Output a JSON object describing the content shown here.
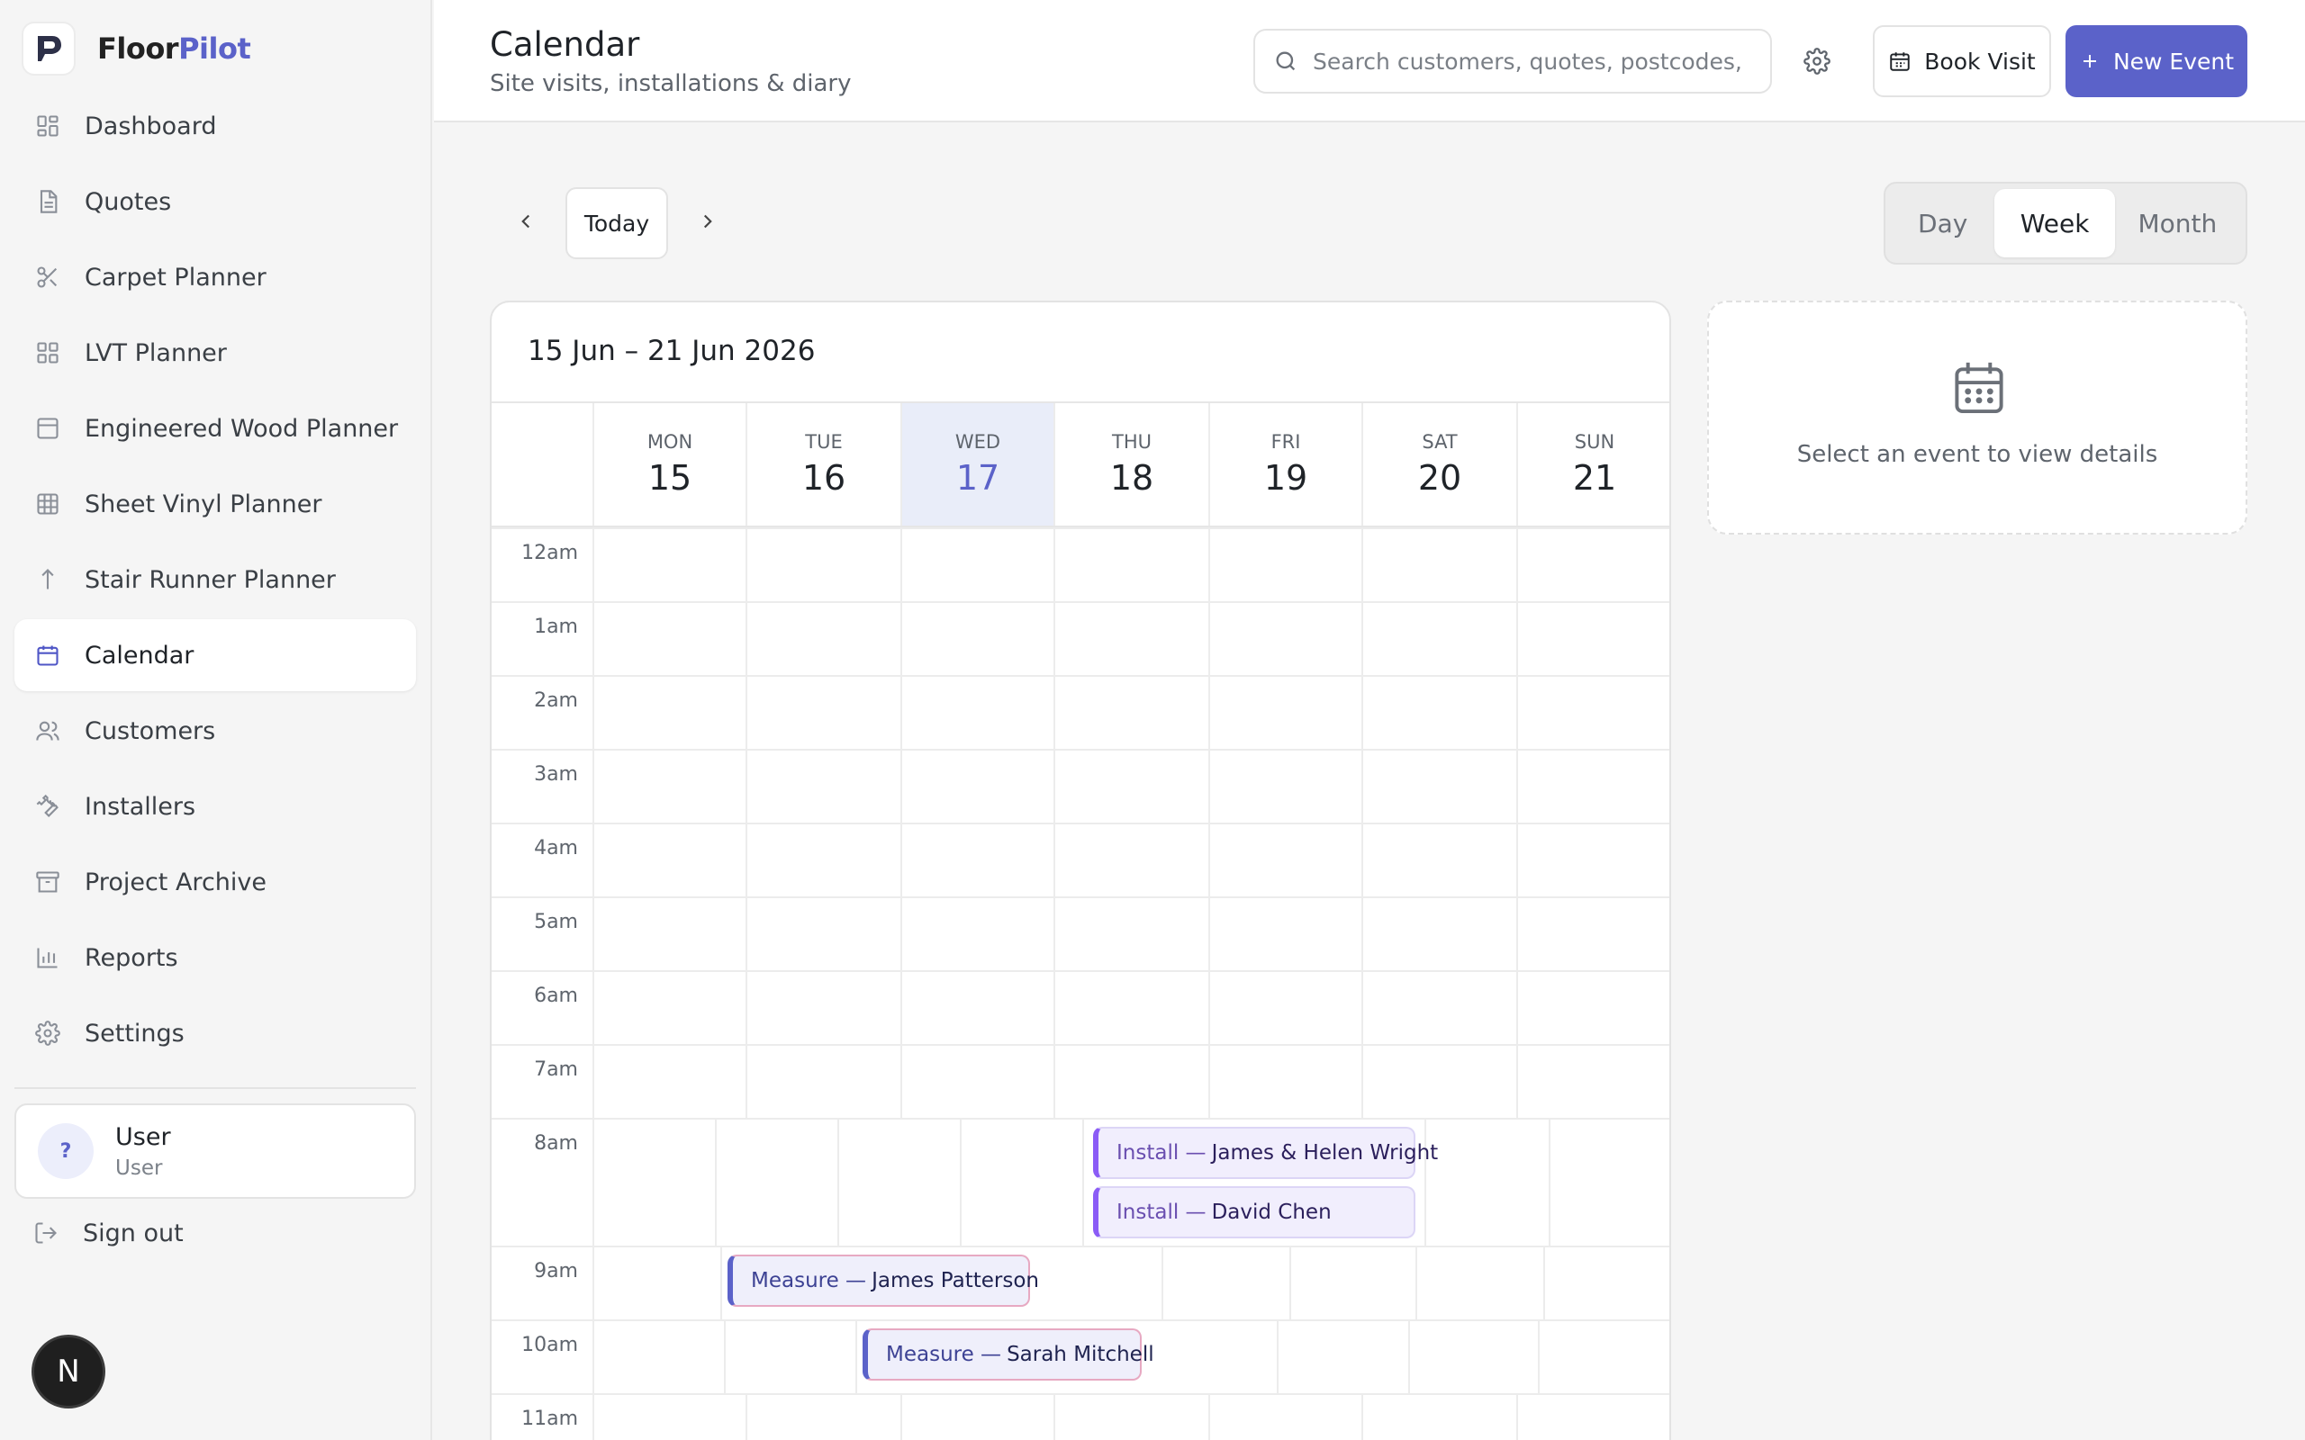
{
  "brand": {
    "name_part1": "Floor",
    "name_part2": "Pilot"
  },
  "sidebar": {
    "items": [
      {
        "label": "Dashboard",
        "icon": "dashboard-icon"
      },
      {
        "label": "Quotes",
        "icon": "document-icon"
      },
      {
        "label": "Carpet Planner",
        "icon": "scissors-icon"
      },
      {
        "label": "LVT Planner",
        "icon": "grid-icon"
      },
      {
        "label": "Engineered Wood Planner",
        "icon": "panel-icon"
      },
      {
        "label": "Sheet Vinyl Planner",
        "icon": "table-icon"
      },
      {
        "label": "Stair Runner Planner",
        "icon": "arrow-up-icon"
      },
      {
        "label": "Calendar",
        "icon": "calendar-icon",
        "active": true
      },
      {
        "label": "Customers",
        "icon": "users-icon"
      },
      {
        "label": "Installers",
        "icon": "wrench-icon"
      },
      {
        "label": "Project Archive",
        "icon": "archive-icon"
      },
      {
        "label": "Reports",
        "icon": "bar-chart-icon"
      },
      {
        "label": "Settings",
        "icon": "gear-icon"
      }
    ],
    "user": {
      "avatar": "?",
      "name": "User",
      "role": "User"
    },
    "signout_label": "Sign out",
    "badge": "N"
  },
  "header": {
    "title": "Calendar",
    "subtitle": "Site visits, installations & diary",
    "search_placeholder": "Search customers, quotes, postcodes, projects...",
    "book_visit_label": "Book Visit",
    "new_event_label": "New Event",
    "accent_color": "#5b62c9"
  },
  "toolbar": {
    "today_label": "Today",
    "views": [
      "Day",
      "Week",
      "Month"
    ],
    "active_view": "Week"
  },
  "calendar": {
    "range": "15 Jun – 21 Jun 2026",
    "days": [
      {
        "name": "MON",
        "num": "15"
      },
      {
        "name": "TUE",
        "num": "16"
      },
      {
        "name": "WED",
        "num": "17",
        "today": true
      },
      {
        "name": "THU",
        "num": "18"
      },
      {
        "name": "FRI",
        "num": "19"
      },
      {
        "name": "SAT",
        "num": "20"
      },
      {
        "name": "SUN",
        "num": "21"
      }
    ],
    "hours": [
      "12am",
      "1am",
      "2am",
      "3am",
      "4am",
      "5am",
      "6am",
      "7am",
      "8am",
      "9am",
      "10am",
      "11am"
    ],
    "events": [
      {
        "type": "Install",
        "name": "James & Helen Wright",
        "kind": "install"
      },
      {
        "type": "Install",
        "name": "David Chen",
        "kind": "install"
      },
      {
        "type": "Measure",
        "name": "James Patterson",
        "kind": "measure"
      },
      {
        "type": "Measure",
        "name": "Sarah Mitchell",
        "kind": "measure"
      }
    ]
  },
  "details": {
    "empty_text": "Select an event to view details"
  }
}
